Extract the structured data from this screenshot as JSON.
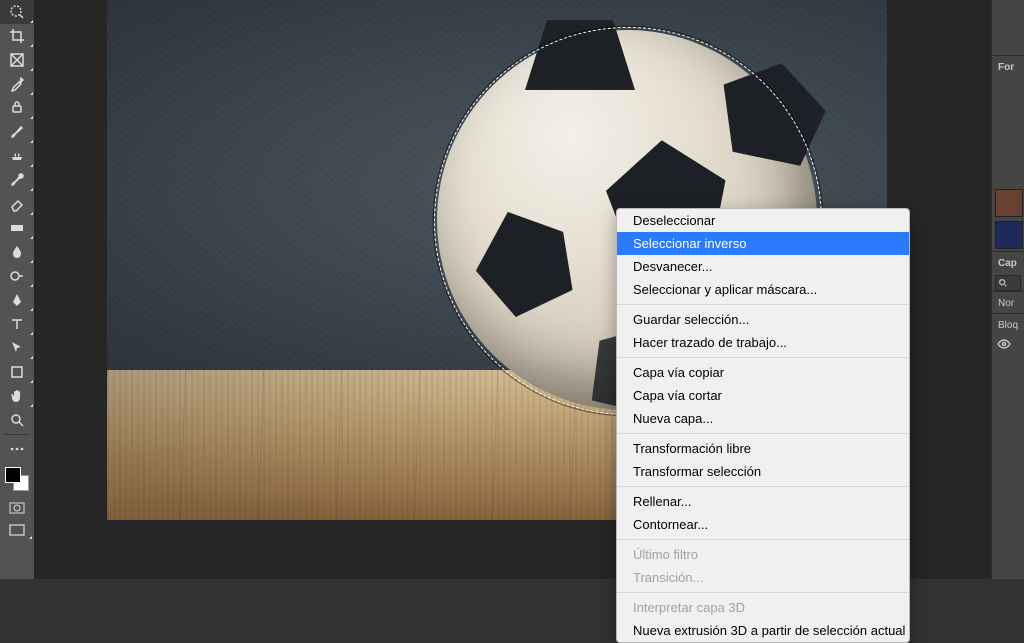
{
  "toolbar_icons": [
    "quick-selection",
    "crop",
    "frame",
    "eyedropper",
    "heal",
    "brush",
    "clone",
    "history-brush",
    "eraser",
    "gradient",
    "blur",
    "dodge",
    "pen",
    "type",
    "path-select",
    "rectangle",
    "hand",
    "zoom"
  ],
  "right_dock": {
    "label1": "For",
    "label_layers": "Cap",
    "label_normal": "Nor",
    "label_block": "Bloq"
  },
  "context_menu": {
    "deselect": "Deseleccionar",
    "select_inverse": "Seleccionar inverso",
    "fade": "Desvanecer...",
    "select_mask": "Seleccionar y aplicar máscara...",
    "save_selection": "Guardar selección...",
    "make_workpath": "Hacer trazado de trabajo...",
    "layer_via_copy": "Capa vía copiar",
    "layer_via_cut": "Capa vía cortar",
    "new_layer": "Nueva capa...",
    "free_transform": "Transformación libre",
    "transform_selection": "Transformar selección",
    "fill": "Rellenar...",
    "stroke": "Contornear...",
    "last_filter": "Último filtro",
    "transition": "Transición...",
    "interpret_3d": "Interpretar capa 3D",
    "new_extrusion_3d": "Nueva extrusión 3D a partir de selección actual"
  }
}
